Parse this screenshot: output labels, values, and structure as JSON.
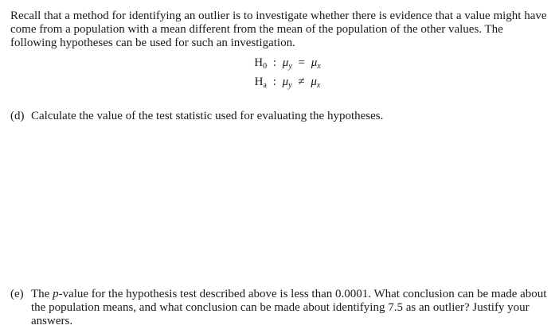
{
  "intro": "Recall that a method for identifying an outlier is to investigate whether there is evidence that a value might have come from a population with a mean different from the mean of the population of the other values. The following hypotheses can be used for such an investigation.",
  "hypotheses": {
    "null": {
      "H": "H",
      "sub": "0",
      "colon": ":",
      "mu1": "μ",
      "sub1": "y",
      "op": "=",
      "mu2": "μ",
      "sub2": "x"
    },
    "alt": {
      "H": "H",
      "sub": "a",
      "colon": ":",
      "mu1": "μ",
      "sub1": "y",
      "op": "≠",
      "mu2": "μ",
      "sub2": "x"
    }
  },
  "parts": {
    "d": {
      "label": "(d)",
      "text": "Calculate the value of the test statistic used for evaluating the hypotheses."
    },
    "e": {
      "label": "(e)",
      "text_before": "The ",
      "text_italic": "p",
      "text_after": "-value for the hypothesis test described above is less than 0.0001. What conclusion can be made about the population means, and what conclusion can be made about identifying 7.5 as an outlier? Justify your answers."
    }
  }
}
